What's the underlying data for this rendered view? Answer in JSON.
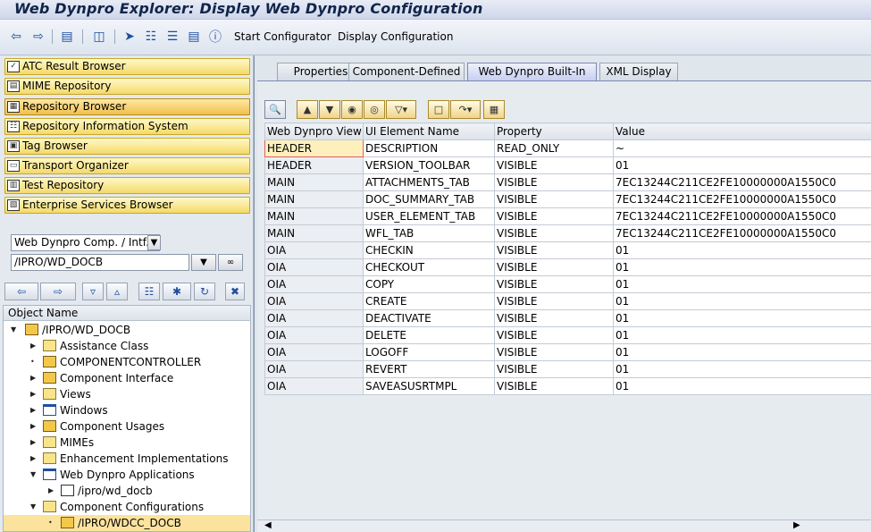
{
  "window": {
    "title": "Web Dynpro Explorer: Display Web Dynpro Configuration"
  },
  "toolbar": {
    "icons": [
      "back-icon",
      "forward-icon",
      "display-icon",
      "other-object-icon",
      "navigate-icon",
      "hierarchy-icon",
      "list-icon",
      "info-icon"
    ],
    "start_configurator": "Start Configurator",
    "display_configuration": "Display Configuration"
  },
  "nav_buttons": [
    {
      "label": "ATC Result Browser",
      "icon": "atc-icon"
    },
    {
      "label": "MIME Repository",
      "icon": "mime-icon"
    },
    {
      "label": "Repository Browser",
      "icon": "repository-icon",
      "active": true
    },
    {
      "label": "Repository Information System",
      "icon": "info-system-icon"
    },
    {
      "label": "Tag Browser",
      "icon": "tag-icon"
    },
    {
      "label": "Transport Organizer",
      "icon": "truck-icon"
    },
    {
      "label": "Test Repository",
      "icon": "test-icon"
    },
    {
      "label": "Enterprise Services Browser",
      "icon": "services-icon"
    }
  ],
  "object_selector": {
    "type_value": "Web Dynpro Comp. / Intf.",
    "name_value": "/IPRO/WD_DOCB"
  },
  "tree": {
    "header": "Object Name",
    "root": "/IPRO/WD_DOCB",
    "items": [
      {
        "label": "Assistance Class",
        "icon": "folder-icon",
        "arrow": "▶"
      },
      {
        "label": "COMPONENTCONTROLLER",
        "icon": "controller-icon",
        "arrow": "•"
      },
      {
        "label": "Component Interface",
        "icon": "interface-icon",
        "arrow": "▶"
      },
      {
        "label": "Views",
        "icon": "folder-icon",
        "arrow": "▶"
      },
      {
        "label": "Windows",
        "icon": "window-icon",
        "arrow": "▶"
      },
      {
        "label": "Component Usages",
        "icon": "usage-icon",
        "arrow": "▶"
      },
      {
        "label": "MIMEs",
        "icon": "folder-icon",
        "arrow": "▶"
      },
      {
        "label": "Enhancement Implementations",
        "icon": "folder-icon",
        "arrow": "▶"
      },
      {
        "label": "Web Dynpro Applications",
        "icon": "application-folder-icon",
        "arrow": "▼"
      },
      {
        "label": "/ipro/wd_docb",
        "icon": "application-icon",
        "arrow": "▶"
      },
      {
        "label": "Component Configurations",
        "icon": "folder-icon",
        "arrow": "▼"
      },
      {
        "label": "/IPRO/WDCC_DOCB",
        "icon": "configuration-icon",
        "arrow": "•"
      }
    ]
  },
  "tabs": [
    {
      "label": "Properties"
    },
    {
      "label": "Component-Defined"
    },
    {
      "label": "Web Dynpro Built-In",
      "active": true
    },
    {
      "label": "XML Display"
    }
  ],
  "grid": {
    "columns": [
      "Web Dynpro View",
      "UI Element Name",
      "Property",
      "Value"
    ],
    "rows": [
      [
        "HEADER",
        "DESCRIPTION",
        "READ_ONLY",
        "~"
      ],
      [
        "HEADER",
        "VERSION_TOOLBAR",
        "VISIBLE",
        "01"
      ],
      [
        "MAIN",
        "ATTACHMENTS_TAB",
        "VISIBLE",
        "7EC13244C211CE2FE10000000A1550C0"
      ],
      [
        "MAIN",
        "DOC_SUMMARY_TAB",
        "VISIBLE",
        "7EC13244C211CE2FE10000000A1550C0"
      ],
      [
        "MAIN",
        "USER_ELEMENT_TAB",
        "VISIBLE",
        "7EC13244C211CE2FE10000000A1550C0"
      ],
      [
        "MAIN",
        "WFL_TAB",
        "VISIBLE",
        "7EC13244C211CE2FE10000000A1550C0"
      ],
      [
        "OIA",
        "CHECKIN",
        "VISIBLE",
        "01"
      ],
      [
        "OIA",
        "CHECKOUT",
        "VISIBLE",
        "01"
      ],
      [
        "OIA",
        "COPY",
        "VISIBLE",
        "01"
      ],
      [
        "OIA",
        "CREATE",
        "VISIBLE",
        "01"
      ],
      [
        "OIA",
        "DEACTIVATE",
        "VISIBLE",
        "01"
      ],
      [
        "OIA",
        "DELETE",
        "VISIBLE",
        "01"
      ],
      [
        "OIA",
        "LOGOFF",
        "VISIBLE",
        "01"
      ],
      [
        "OIA",
        "REVERT",
        "VISIBLE",
        "01"
      ],
      [
        "OIA",
        "SAVEASUSRTMPL",
        "VISIBLE",
        "01"
      ]
    ]
  },
  "colors": {
    "accent": "#1f4ea0",
    "nav_button": "#f4d96a",
    "selected_row": "#fbe39e",
    "active_tab": "#c7cff0"
  }
}
